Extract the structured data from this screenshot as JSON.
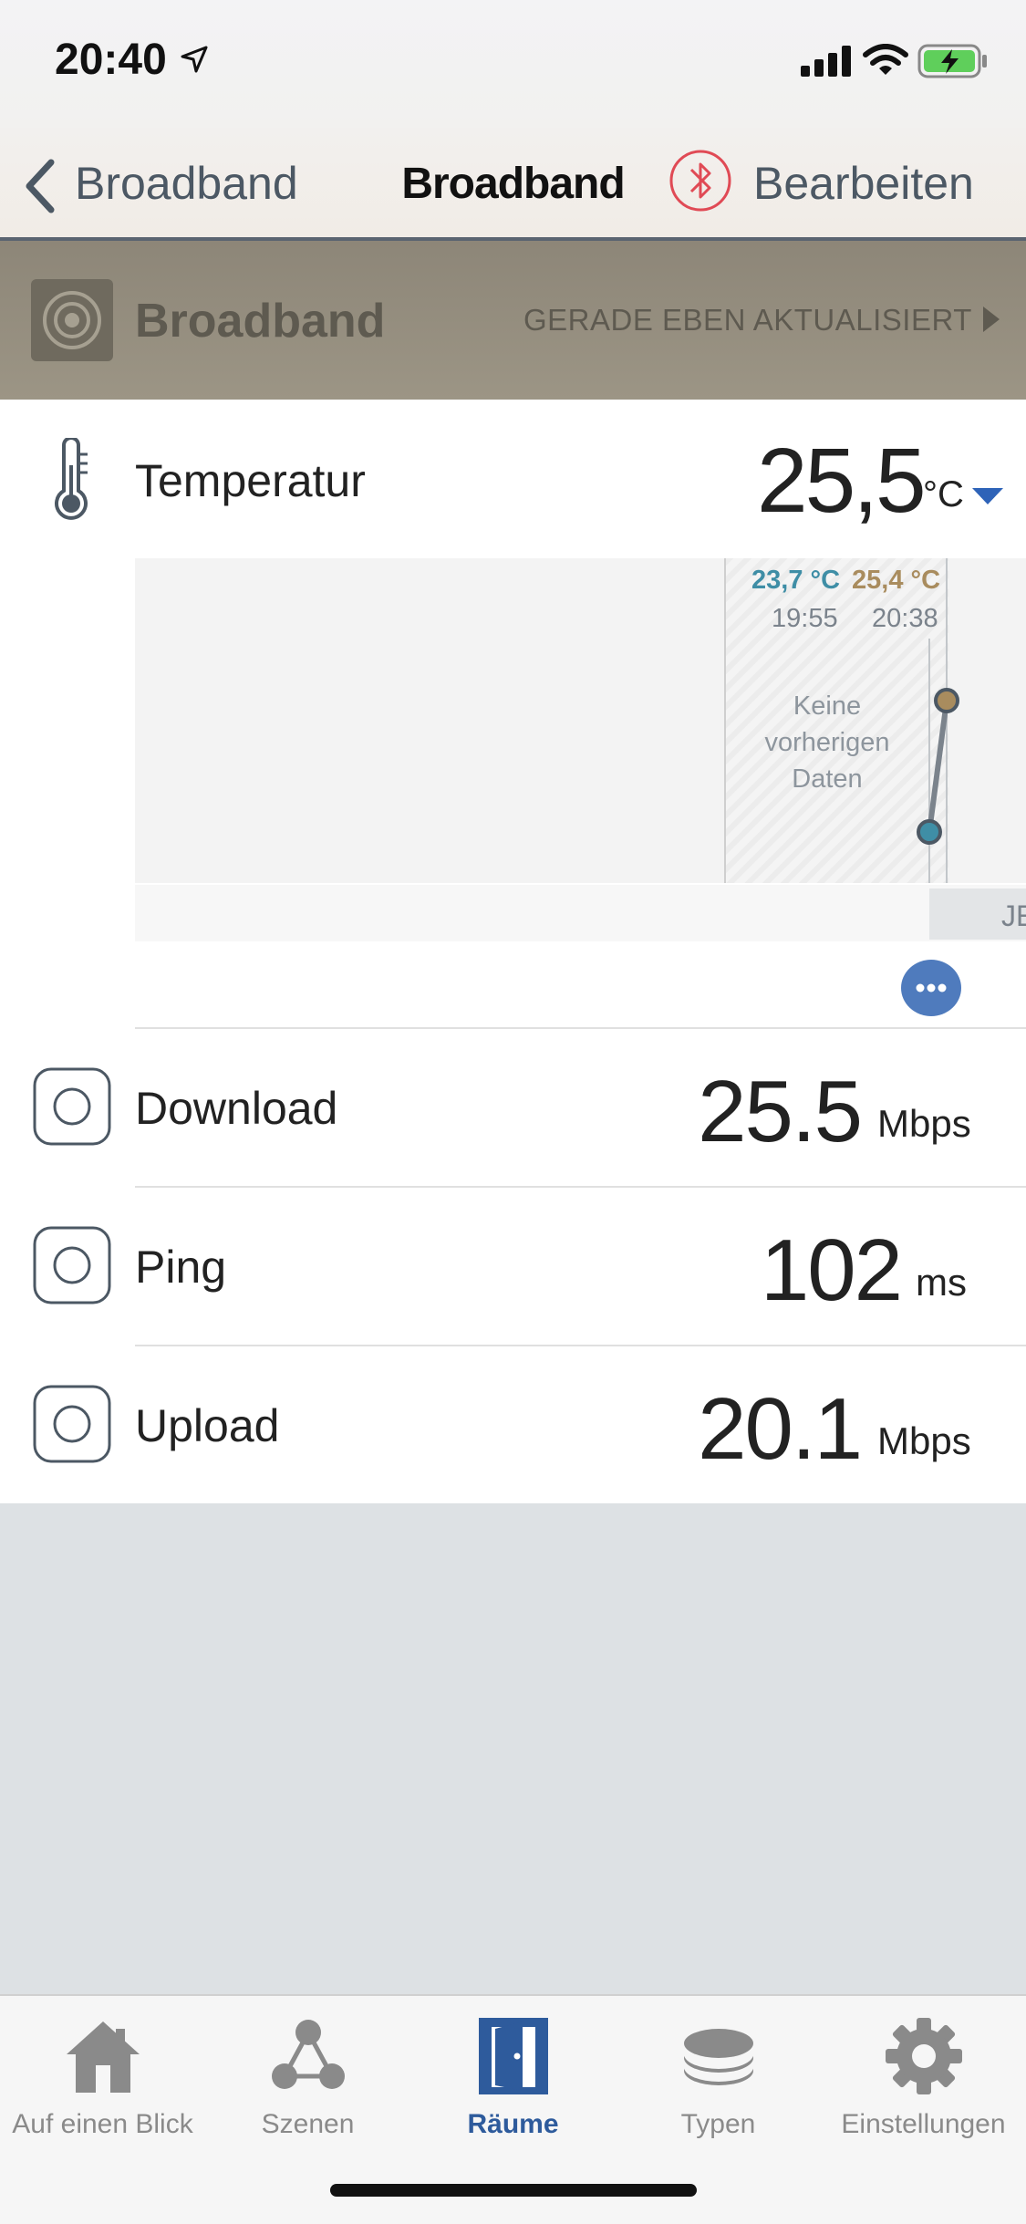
{
  "status_bar": {
    "time": "20:40"
  },
  "nav": {
    "back_label": "Broadband",
    "title": "Broadband",
    "edit_label": "Bearbeiten"
  },
  "device": {
    "name": "Broadband",
    "updated": "GERADE EBEN AKTUALISIERT"
  },
  "temperature": {
    "label": "Temperatur",
    "value": "25,5",
    "unit": "°C",
    "chart": {
      "min_label": "23,7 °C",
      "min_time": "19:55",
      "max_label": "25,4 °C",
      "max_time": "20:38",
      "no_data": "Keine vorherigen Daten",
      "footer_label": "JE",
      "colors": {
        "min": "#3f8ea6",
        "max": "#a98c5e"
      }
    }
  },
  "chart_data": {
    "type": "line",
    "x": [
      "19:55",
      "20:38"
    ],
    "series": [
      {
        "values": [
          23.7,
          25.4
        ]
      }
    ],
    "annotations": [
      "Keine vorherigen Daten"
    ]
  },
  "rows": [
    {
      "label": "Download",
      "value": "25.5",
      "unit": "Mbps"
    },
    {
      "label": "Ping",
      "value": "102",
      "unit": "ms"
    },
    {
      "label": "Upload",
      "value": "20.1",
      "unit": "Mbps"
    }
  ],
  "tabs": [
    {
      "label": "Auf einen Blick",
      "icon": "house-icon"
    },
    {
      "label": "Szenen",
      "icon": "scenes-icon"
    },
    {
      "label": "Räume",
      "icon": "door-icon",
      "active": true
    },
    {
      "label": "Typen",
      "icon": "layers-icon"
    },
    {
      "label": "Einstellungen",
      "icon": "gear-icon"
    }
  ],
  "colors": {
    "accent": "#2e5b9c",
    "bluetooth": "#e04a55",
    "header_band": "#958e80"
  }
}
